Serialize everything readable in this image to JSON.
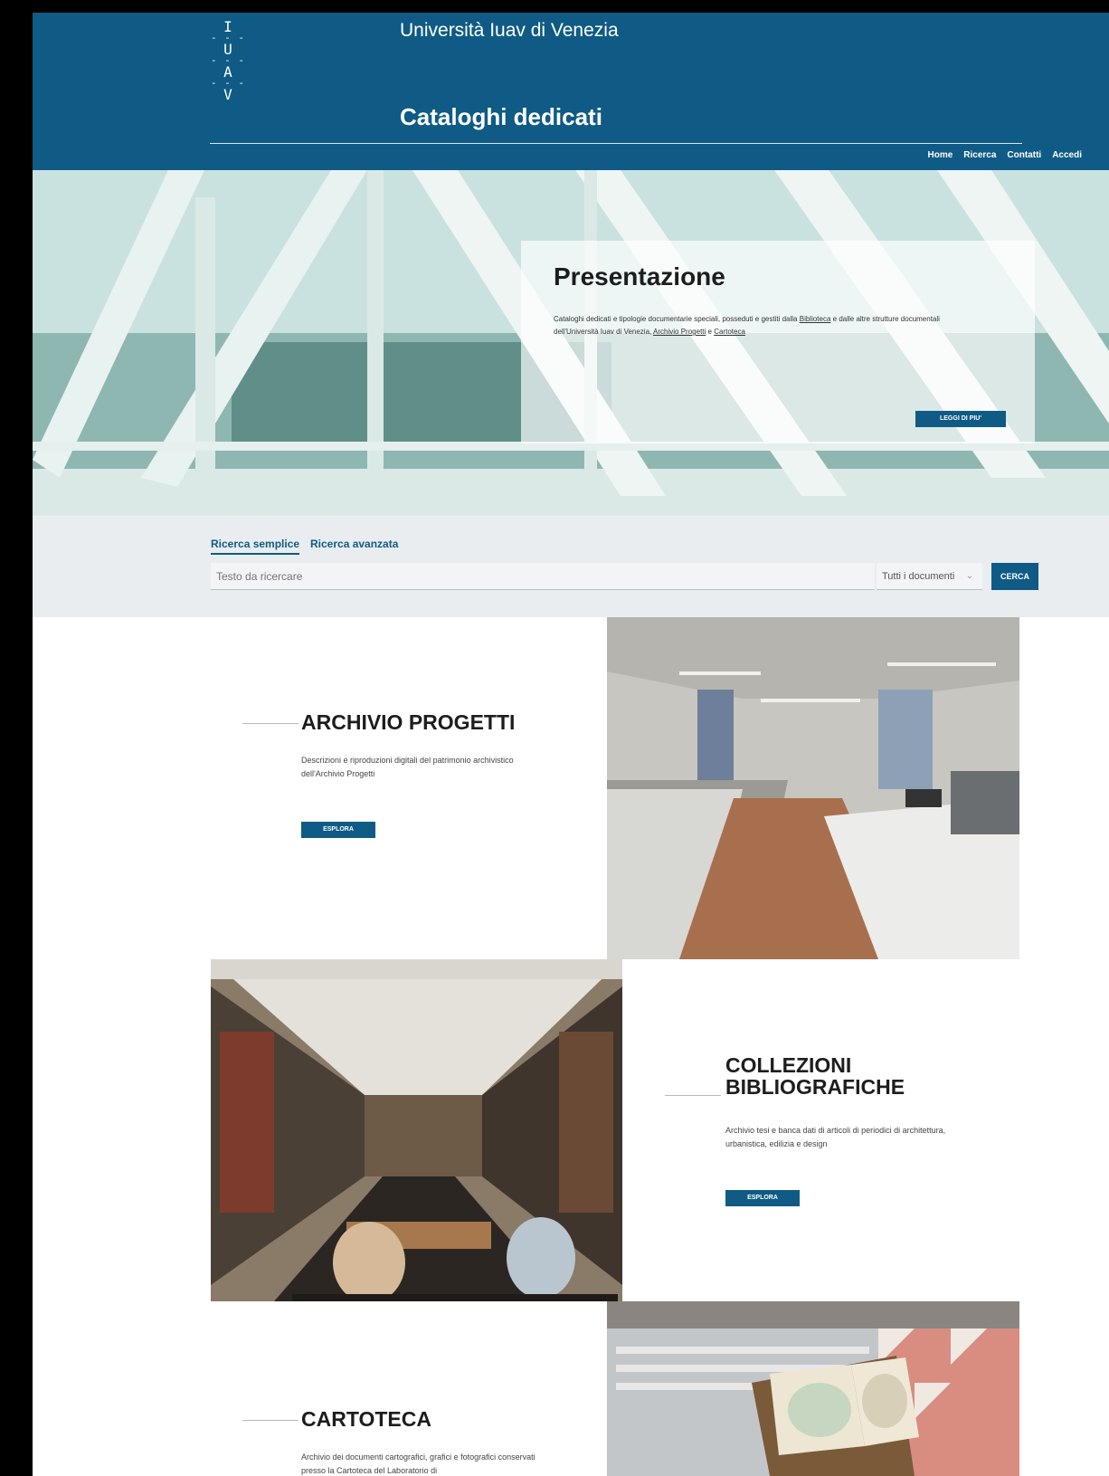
{
  "header": {
    "logo_letters": [
      "I",
      "U",
      "A",
      "V"
    ],
    "logo_separator": "- - -",
    "university_name": "Università Iuav di Venezia",
    "site_title": "Cataloghi dedicati",
    "nav": [
      "Home",
      "Ricerca",
      "Contatti",
      "Accedi"
    ]
  },
  "hero": {
    "title": "Presentazione",
    "text_before": "Cataloghi dedicati e tipologie documentarie speciali, posseduti e gestiti dalla ",
    "link_biblioteca": "Biblioteca",
    "text_middle": " e dalle altre strutture documentali dell'Università Iuav di Venezia, ",
    "link_archivio": "Archivio Progetti",
    "text_and": " e ",
    "link_cartoteca": "Cartoteca",
    "button": "LEGGI DI PIU'"
  },
  "search": {
    "tab_simple": "Ricerca semplice",
    "tab_advanced": "Ricerca avanzata",
    "placeholder": "Testo da ricercare",
    "select_value": "Tutti i documenti",
    "button": "CERCA"
  },
  "sections": [
    {
      "title": "ARCHIVIO PROGETTI",
      "description": "Descrizioni e riproduzioni digitali del patrimonio archivistico dell'Archivio Progetti",
      "button": "ESPLORA"
    },
    {
      "title_line1": "COLLEZIONI",
      "title_line2": "BIBLIOGRAFICHE",
      "description": "Archivio tesi e banca dati di articoli di periodici di architettura, urbanistica, edilizia e design",
      "button": "ESPLORA"
    },
    {
      "title": "CARTOTECA",
      "description": "Archivio dei documenti cartografici, grafici e fotografici conservati presso la Cartoteca del Laboratorio di"
    }
  ],
  "colors": {
    "brand_blue": "#0f5b85",
    "search_bg": "#eaedf0"
  }
}
